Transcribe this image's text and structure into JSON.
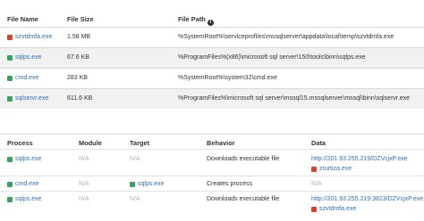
{
  "files_table": {
    "headers": {
      "name": "File Name",
      "size": "File Size",
      "path": "File Path"
    },
    "rows": [
      {
        "name": "szvtdmfa.exe",
        "size": "1.58 MB",
        "path": "%SystemRoot%\\serviceprofiles\\mssqlserver\\appdata\\local\\temp\\szvtdmfa.exe",
        "color": "#d9412b"
      },
      {
        "name": "sqlps.exe",
        "size": "67.6 KB",
        "path": "%ProgramFiles%(x86)\\microsoft sql server\\150\\tools\\binn\\sqlps.exe",
        "color": "#3aa35b"
      },
      {
        "name": "cmd.exe",
        "size": "283 KB",
        "path": "%SystemRoot%\\system32\\cmd.exe",
        "color": "#3aa35b"
      },
      {
        "name": "sqlservr.exe",
        "size": "611.6 KB",
        "path": "%ProgramFiles%\\microsoft sql server\\mssql15.mssqlserver\\mssql\\binn\\sqlservr.exe",
        "color": "#3aa35b"
      }
    ]
  },
  "process_table": {
    "headers": {
      "process": "Process",
      "module": "Module",
      "target": "Target",
      "behavior": "Behavior",
      "data": "Data"
    },
    "rows": [
      {
        "process": "sqlps.exe",
        "process_color": "#3aa35b",
        "module": "N/A",
        "target": "N/A",
        "target_muted": true,
        "behavior": "Downloads executable file",
        "data_link": "http://201.93.255.219/DZVcjxP.exe",
        "data_file": "zrurtiza.exe",
        "data_file_color": "#d9412b"
      },
      {
        "process": "cmd.exe",
        "process_color": "#3aa35b",
        "module": "N/A",
        "target": "sqlps.exe",
        "target_color": "#3aa35b",
        "target_muted": false,
        "behavior": "Creates process",
        "data_link": "N/A",
        "data_file": ""
      },
      {
        "process": "sqlps.exe",
        "process_color": "#3aa35b",
        "module": "N/A",
        "target": "N/A",
        "target_muted": true,
        "behavior": "Downloads executable file",
        "data_link": "http://201.93.255.219:3823/DZVcjxP.exe",
        "data_file": "szvtdmfa.exe",
        "data_file_color": "#d9412b"
      }
    ]
  }
}
